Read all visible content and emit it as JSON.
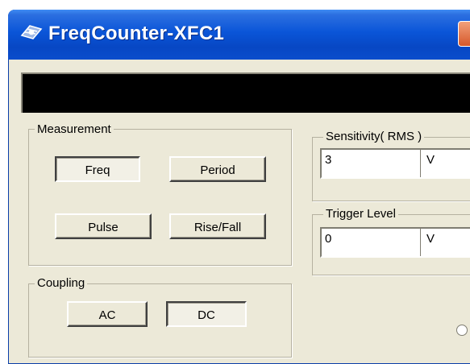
{
  "window": {
    "title": "FreqCounter-XFC1",
    "icon": "gear-icon"
  },
  "display": {
    "value": ""
  },
  "measurement": {
    "label": "Measurement",
    "buttons": [
      {
        "label": "Freq",
        "pressed": true
      },
      {
        "label": "Period",
        "pressed": false
      },
      {
        "label": "Pulse",
        "pressed": false
      },
      {
        "label": "Rise/Fall",
        "pressed": false
      }
    ]
  },
  "coupling": {
    "label": "Coupling",
    "buttons": [
      {
        "label": "AC",
        "pressed": false
      },
      {
        "label": "DC",
        "pressed": true
      }
    ]
  },
  "sensitivity": {
    "label": "Sensitivity( RMS )",
    "value": "3",
    "unit": "V"
  },
  "trigger": {
    "label": "Trigger Level",
    "value": "0",
    "unit": "V"
  },
  "colors": {
    "titlebar": "#0a55d8",
    "window_bg": "#ece9d8",
    "display_bg": "#000000",
    "close": "#d6582a"
  }
}
